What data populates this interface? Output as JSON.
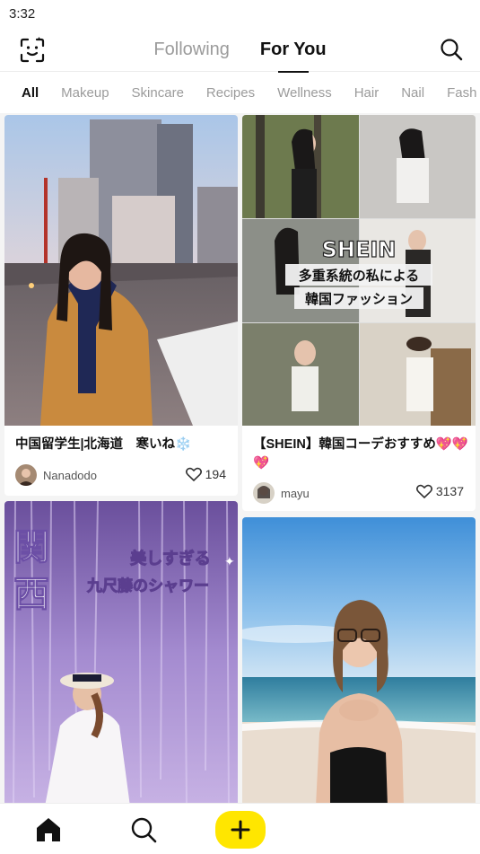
{
  "status_bar": {
    "time": "3:32"
  },
  "header": {
    "tabs": [
      {
        "label": "Following",
        "active": false
      },
      {
        "label": "For You",
        "active": true
      }
    ],
    "left_icon": "face-scan-icon",
    "right_icon": "search-icon"
  },
  "categories": [
    "All",
    "Makeup",
    "Skincare",
    "Recipes",
    "Wellness",
    "Hair",
    "Nail",
    "Fash"
  ],
  "active_category": "All",
  "posts": [
    {
      "title": "中国留学生|北海道　寒いね❄️",
      "author": "Nanadodo",
      "likes": "194"
    },
    {
      "title": "【SHEIN】韓国コーデおすすめ💖💖💖",
      "author": "mayu",
      "likes": "3137",
      "overlay_brand": "SHEIN",
      "overlay_line1": "多重系統の私による",
      "overlay_line2": "韓国ファッション"
    },
    {
      "overlay_big": "関西",
      "overlay_line1": "美しすぎる",
      "overlay_line2": "九尺藤のシャワー"
    },
    {}
  ],
  "bottom_nav": {
    "home_icon": "home-icon",
    "search_icon": "search-icon",
    "post_icon": "plus-icon"
  },
  "colors": {
    "accent_yellow": "#ffe600",
    "text_primary": "#111111",
    "text_muted": "#9b9b9b"
  }
}
